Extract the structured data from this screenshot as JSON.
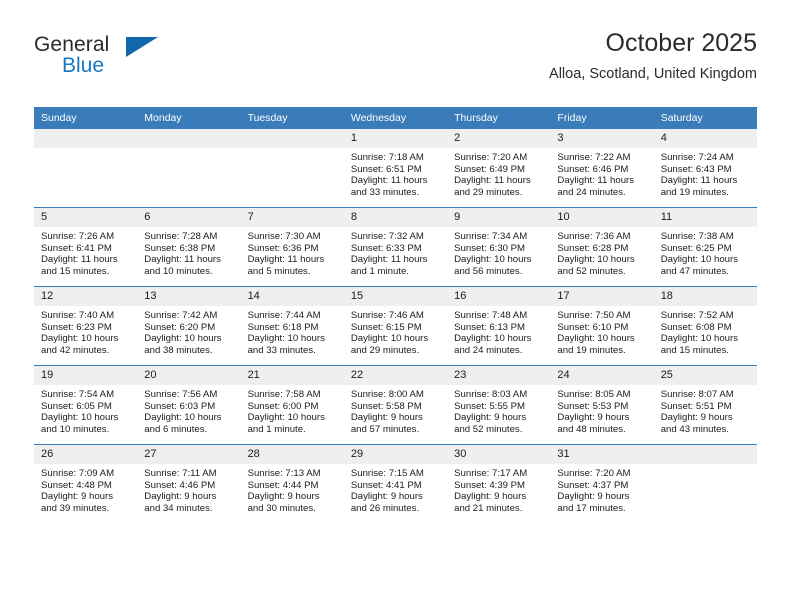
{
  "brand": {
    "name_part1": "General",
    "name_part2": "Blue",
    "triangle_icon": "triangle-icon"
  },
  "header": {
    "title": "October 2025",
    "location": "Alloa, Scotland, United Kingdom"
  },
  "weekdays": [
    "Sunday",
    "Monday",
    "Tuesday",
    "Wednesday",
    "Thursday",
    "Friday",
    "Saturday"
  ],
  "colors": {
    "header_band": "#3a7cb9",
    "date_band": "#efefef",
    "brand_blue": "#1a78c2",
    "text": "#1c1c1c"
  },
  "labels": {
    "sunrise_prefix": "Sunrise:",
    "sunset_prefix": "Sunset:",
    "daylight_prefix": "Daylight:"
  },
  "weeks": [
    [
      {
        "day": "",
        "empty": true
      },
      {
        "day": "",
        "empty": true
      },
      {
        "day": "",
        "empty": true
      },
      {
        "day": "1",
        "sunrise": "Sunrise: 7:18 AM",
        "sunset": "Sunset: 6:51 PM",
        "daylight": "Daylight: 11 hours and 33 minutes."
      },
      {
        "day": "2",
        "sunrise": "Sunrise: 7:20 AM",
        "sunset": "Sunset: 6:49 PM",
        "daylight": "Daylight: 11 hours and 29 minutes."
      },
      {
        "day": "3",
        "sunrise": "Sunrise: 7:22 AM",
        "sunset": "Sunset: 6:46 PM",
        "daylight": "Daylight: 11 hours and 24 minutes."
      },
      {
        "day": "4",
        "sunrise": "Sunrise: 7:24 AM",
        "sunset": "Sunset: 6:43 PM",
        "daylight": "Daylight: 11 hours and 19 minutes."
      }
    ],
    [
      {
        "day": "5",
        "sunrise": "Sunrise: 7:26 AM",
        "sunset": "Sunset: 6:41 PM",
        "daylight": "Daylight: 11 hours and 15 minutes."
      },
      {
        "day": "6",
        "sunrise": "Sunrise: 7:28 AM",
        "sunset": "Sunset: 6:38 PM",
        "daylight": "Daylight: 11 hours and 10 minutes."
      },
      {
        "day": "7",
        "sunrise": "Sunrise: 7:30 AM",
        "sunset": "Sunset: 6:36 PM",
        "daylight": "Daylight: 11 hours and 5 minutes."
      },
      {
        "day": "8",
        "sunrise": "Sunrise: 7:32 AM",
        "sunset": "Sunset: 6:33 PM",
        "daylight": "Daylight: 11 hours and 1 minute."
      },
      {
        "day": "9",
        "sunrise": "Sunrise: 7:34 AM",
        "sunset": "Sunset: 6:30 PM",
        "daylight": "Daylight: 10 hours and 56 minutes."
      },
      {
        "day": "10",
        "sunrise": "Sunrise: 7:36 AM",
        "sunset": "Sunset: 6:28 PM",
        "daylight": "Daylight: 10 hours and 52 minutes."
      },
      {
        "day": "11",
        "sunrise": "Sunrise: 7:38 AM",
        "sunset": "Sunset: 6:25 PM",
        "daylight": "Daylight: 10 hours and 47 minutes."
      }
    ],
    [
      {
        "day": "12",
        "sunrise": "Sunrise: 7:40 AM",
        "sunset": "Sunset: 6:23 PM",
        "daylight": "Daylight: 10 hours and 42 minutes."
      },
      {
        "day": "13",
        "sunrise": "Sunrise: 7:42 AM",
        "sunset": "Sunset: 6:20 PM",
        "daylight": "Daylight: 10 hours and 38 minutes."
      },
      {
        "day": "14",
        "sunrise": "Sunrise: 7:44 AM",
        "sunset": "Sunset: 6:18 PM",
        "daylight": "Daylight: 10 hours and 33 minutes."
      },
      {
        "day": "15",
        "sunrise": "Sunrise: 7:46 AM",
        "sunset": "Sunset: 6:15 PM",
        "daylight": "Daylight: 10 hours and 29 minutes."
      },
      {
        "day": "16",
        "sunrise": "Sunrise: 7:48 AM",
        "sunset": "Sunset: 6:13 PM",
        "daylight": "Daylight: 10 hours and 24 minutes."
      },
      {
        "day": "17",
        "sunrise": "Sunrise: 7:50 AM",
        "sunset": "Sunset: 6:10 PM",
        "daylight": "Daylight: 10 hours and 19 minutes."
      },
      {
        "day": "18",
        "sunrise": "Sunrise: 7:52 AM",
        "sunset": "Sunset: 6:08 PM",
        "daylight": "Daylight: 10 hours and 15 minutes."
      }
    ],
    [
      {
        "day": "19",
        "sunrise": "Sunrise: 7:54 AM",
        "sunset": "Sunset: 6:05 PM",
        "daylight": "Daylight: 10 hours and 10 minutes."
      },
      {
        "day": "20",
        "sunrise": "Sunrise: 7:56 AM",
        "sunset": "Sunset: 6:03 PM",
        "daylight": "Daylight: 10 hours and 6 minutes."
      },
      {
        "day": "21",
        "sunrise": "Sunrise: 7:58 AM",
        "sunset": "Sunset: 6:00 PM",
        "daylight": "Daylight: 10 hours and 1 minute."
      },
      {
        "day": "22",
        "sunrise": "Sunrise: 8:00 AM",
        "sunset": "Sunset: 5:58 PM",
        "daylight": "Daylight: 9 hours and 57 minutes."
      },
      {
        "day": "23",
        "sunrise": "Sunrise: 8:03 AM",
        "sunset": "Sunset: 5:55 PM",
        "daylight": "Daylight: 9 hours and 52 minutes."
      },
      {
        "day": "24",
        "sunrise": "Sunrise: 8:05 AM",
        "sunset": "Sunset: 5:53 PM",
        "daylight": "Daylight: 9 hours and 48 minutes."
      },
      {
        "day": "25",
        "sunrise": "Sunrise: 8:07 AM",
        "sunset": "Sunset: 5:51 PM",
        "daylight": "Daylight: 9 hours and 43 minutes."
      }
    ],
    [
      {
        "day": "26",
        "sunrise": "Sunrise: 7:09 AM",
        "sunset": "Sunset: 4:48 PM",
        "daylight": "Daylight: 9 hours and 39 minutes."
      },
      {
        "day": "27",
        "sunrise": "Sunrise: 7:11 AM",
        "sunset": "Sunset: 4:46 PM",
        "daylight": "Daylight: 9 hours and 34 minutes."
      },
      {
        "day": "28",
        "sunrise": "Sunrise: 7:13 AM",
        "sunset": "Sunset: 4:44 PM",
        "daylight": "Daylight: 9 hours and 30 minutes."
      },
      {
        "day": "29",
        "sunrise": "Sunrise: 7:15 AM",
        "sunset": "Sunset: 4:41 PM",
        "daylight": "Daylight: 9 hours and 26 minutes."
      },
      {
        "day": "30",
        "sunrise": "Sunrise: 7:17 AM",
        "sunset": "Sunset: 4:39 PM",
        "daylight": "Daylight: 9 hours and 21 minutes."
      },
      {
        "day": "31",
        "sunrise": "Sunrise: 7:20 AM",
        "sunset": "Sunset: 4:37 PM",
        "daylight": "Daylight: 9 hours and 17 minutes."
      },
      {
        "day": "",
        "empty": true
      }
    ]
  ]
}
